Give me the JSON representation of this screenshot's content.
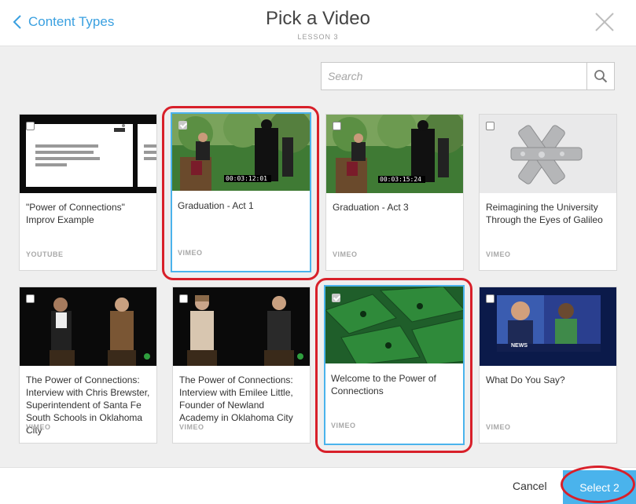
{
  "header": {
    "back_label": "Content Types",
    "title": "Pick a Video",
    "subtitle": "LESSON 3"
  },
  "search": {
    "placeholder": "Search",
    "value": ""
  },
  "videos": [
    {
      "title": "\"Power of Connections\" Improv Example",
      "source": "YOUTUBE",
      "selected": false,
      "thumb_text": "For this improvisation, I'm going to show you an object. It's something you've likely seen before."
    },
    {
      "title": "Graduation - Act 1",
      "source": "VIMEO",
      "selected": true,
      "timecode": "00:03:12:01"
    },
    {
      "title": "Graduation - Act 3",
      "source": "VIMEO",
      "selected": false,
      "timecode": "00:03:15:24"
    },
    {
      "title": "Reimagining the University Through the Eyes of Galileo",
      "source": "VIMEO",
      "selected": false
    },
    {
      "title": "The Power of Connections: Interview with Chris Brewster, Superintendent of Santa Fe South Schools in Oklahoma City",
      "source": "VIMEO",
      "selected": false
    },
    {
      "title": "The Power of Connections: Interview with Emilee Little, Founder of Newland Academy in Oklahoma City",
      "source": "VIMEO",
      "selected": false
    },
    {
      "title": "Welcome to the Power of Connections",
      "source": "VIMEO",
      "selected": true
    },
    {
      "title": "What Do You Say?",
      "source": "VIMEO",
      "selected": false,
      "thumb_text": "NEWS"
    }
  ],
  "footer": {
    "cancel_label": "Cancel",
    "select_label": "Select 2"
  },
  "colors": {
    "accent": "#4ab3ec",
    "highlight_ring": "#d8202a",
    "link": "#3aa0e0"
  }
}
